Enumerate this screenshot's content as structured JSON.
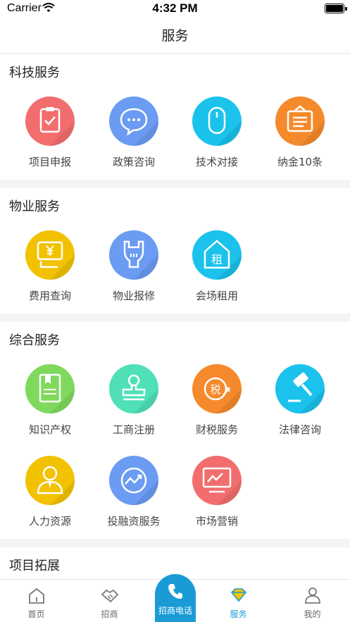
{
  "status": {
    "carrier": "Carrier",
    "time": "4:32 PM"
  },
  "nav": {
    "title": "服务"
  },
  "sections": [
    {
      "title": "科技服务",
      "items": [
        {
          "label": "项目申报",
          "icon": "clipboard-check-icon",
          "color": "#f26e6e"
        },
        {
          "label": "政策咨询",
          "icon": "chat-bubble-icon",
          "color": "#6b9bf2"
        },
        {
          "label": "技术对接",
          "icon": "mouse-icon",
          "color": "#1bc2ec"
        },
        {
          "label": "纳金10条",
          "icon": "signboard-icon",
          "color": "#f58a2c"
        }
      ]
    },
    {
      "title": "物业服务",
      "items": [
        {
          "label": "费用查询",
          "icon": "yen-bill-icon",
          "color": "#f2c200"
        },
        {
          "label": "物业报修",
          "icon": "plug-icon",
          "color": "#6b9bf2"
        },
        {
          "label": "会场租用",
          "icon": "rent-house-icon",
          "color": "#1bc2ec",
          "glyph": "租"
        }
      ]
    },
    {
      "title": "综合服务",
      "items": [
        {
          "label": "知识产权",
          "icon": "book-icon",
          "color": "#7ed95d"
        },
        {
          "label": "工商注册",
          "icon": "stamp-icon",
          "color": "#4fe0b8"
        },
        {
          "label": "财税服务",
          "icon": "tax-icon",
          "color": "#f58a2c",
          "glyph": "税"
        },
        {
          "label": "法律咨询",
          "icon": "gavel-icon",
          "color": "#1bc2ec"
        },
        {
          "label": "人力资源",
          "icon": "person-icon",
          "color": "#f2c200"
        },
        {
          "label": "投融资服务",
          "icon": "growth-chart-icon",
          "color": "#6b9bf2"
        },
        {
          "label": "市场营销",
          "icon": "monitor-chart-icon",
          "color": "#f26e6e"
        }
      ]
    },
    {
      "title": "项目拓展",
      "items": []
    }
  ],
  "tabs": [
    {
      "label": "首页",
      "icon": "home-icon"
    },
    {
      "label": "招商",
      "icon": "handshake-icon"
    },
    {
      "label": "招商电话",
      "icon": "phone-icon"
    },
    {
      "label": "服务",
      "icon": "diamond-icon",
      "active": true
    },
    {
      "label": "我的",
      "icon": "user-icon"
    }
  ],
  "colors": {
    "accent": "#1a9bd6"
  }
}
